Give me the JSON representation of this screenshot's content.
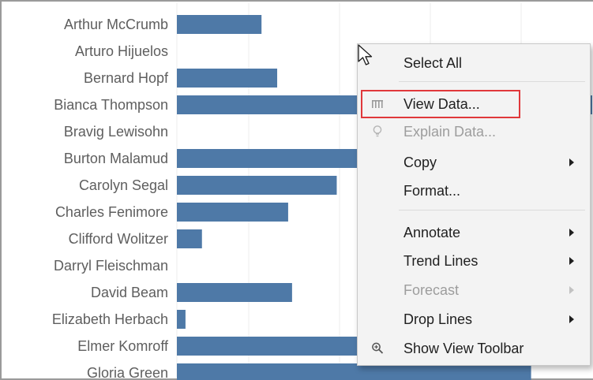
{
  "chart_data": {
    "type": "bar",
    "orientation": "horizontal",
    "categories": [
      "Arthur McCrumb",
      "Arturo Hijuelos",
      "Bernard Hopf",
      "Bianca Thompson",
      "Bravig Lewisohn",
      "Burton Malamud",
      "Carolyn Segal",
      "Charles Fenimore",
      "Clifford Wolitzer",
      "Darryl Fleischman",
      "David Beam",
      "Elizabeth Herbach",
      "Elmer Komroff",
      "Gloria Green"
    ],
    "values": [
      108,
      0,
      128,
      530,
      0,
      480,
      204,
      142,
      32,
      0,
      147,
      11,
      300,
      452
    ],
    "xlim": [
      0,
      530
    ],
    "grid": true,
    "bar_color": "#4e79a7",
    "label_color": "#5e5e5e",
    "grid_color": "#ececec"
  },
  "context_menu": {
    "items": [
      {
        "label": "Select All",
        "icon": "",
        "submenu": false,
        "disabled": false
      },
      {
        "label": "View Data...",
        "icon": "view-data-icon",
        "submenu": false,
        "disabled": false,
        "highlighted": true
      },
      {
        "label": "Explain Data...",
        "icon": "lightbulb-icon",
        "submenu": false,
        "disabled": true
      },
      {
        "label": "Copy",
        "icon": "",
        "submenu": true,
        "disabled": false
      },
      {
        "label": "Format...",
        "icon": "",
        "submenu": false,
        "disabled": false
      },
      {
        "label": "Annotate",
        "icon": "",
        "submenu": true,
        "disabled": false
      },
      {
        "label": "Trend Lines",
        "icon": "",
        "submenu": true,
        "disabled": false
      },
      {
        "label": "Forecast",
        "icon": "",
        "submenu": true,
        "disabled": true
      },
      {
        "label": "Drop Lines",
        "icon": "",
        "submenu": true,
        "disabled": false
      },
      {
        "label": "Show View Toolbar",
        "icon": "zoom-icon",
        "submenu": false,
        "disabled": false
      }
    ],
    "highlight_color": "#e0383b"
  }
}
